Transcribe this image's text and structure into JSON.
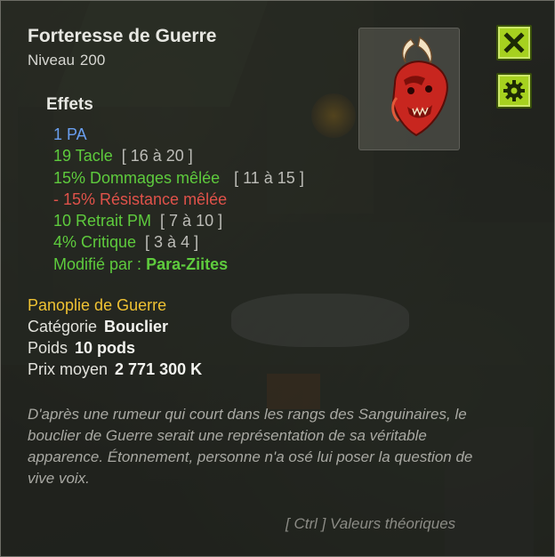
{
  "item": {
    "name": "Forteresse de Guerre",
    "level_label": "Niveau",
    "level_value": "200"
  },
  "buttons": {
    "close_icon": "close-icon",
    "settings_icon": "gear-icon"
  },
  "effects": {
    "title": "Effets",
    "ap": "1 PA",
    "tackle": "19 Tacle",
    "tackle_range": "[ 16 à 20 ]",
    "melee_damage": "15% Dommages mêlée",
    "melee_damage_range": "[ 11 à 15 ]",
    "melee_resistance": "- 15% Résistance mêlée",
    "mp_reduction": "10 Retrait PM",
    "mp_reduction_range": "[ 7 à 10 ]",
    "critical": "4% Critique",
    "critical_range": "[ 3 à 4 ]",
    "modified_by_label": "Modifié par :",
    "modified_by_name": "Para-Ziites"
  },
  "info": {
    "set_name": "Panoplie de Guerre",
    "category_label": "Catégorie",
    "category_value": "Bouclier",
    "weight_label": "Poids",
    "weight_value": "10 pods",
    "price_label": "Prix moyen",
    "price_value": "2 771 300 K"
  },
  "description": "D'après une rumeur qui court dans les rangs des Sanguinaires, le bouclier de Guerre serait une représentation de sa véritable apparence. Étonnement, personne n'a osé lui poser la question de vive voix.",
  "footer": {
    "ctrl_hint": "[ Ctrl ] Valeurs théoriques"
  },
  "colors": {
    "ap": "#6a9ff0",
    "bonus": "#5ecb3d",
    "malus": "#e0524a",
    "set": "#efc233",
    "button": "#a6d11f"
  }
}
